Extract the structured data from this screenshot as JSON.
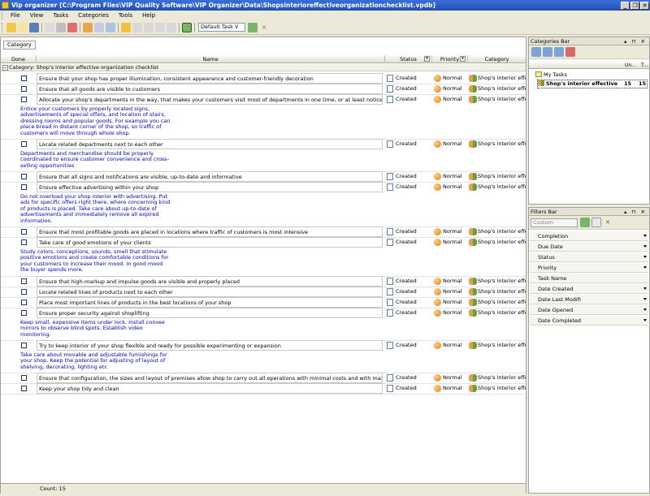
{
  "window": {
    "title": "Vip organizer [C:\\Program Files\\VIP Quality Software\\VIP Organizer\\Data\\Shopsinterioreffectiveorganizationchecklist.vpdb]",
    "buttons": [
      "_",
      "❒",
      "✕"
    ]
  },
  "menu": [
    "File",
    "View",
    "Tasks",
    "Categories",
    "Tools",
    "Help"
  ],
  "toolbar": {
    "view_select": "Default Task V"
  },
  "tasklist": {
    "group_by_label": "Category",
    "columns": {
      "done": "Done",
      "name": "Name",
      "status": "Status",
      "priority": "Priority",
      "category": "Category"
    },
    "group_label": "Category: Shop's interior effective organization checklist",
    "items": [
      {
        "name": "Ensure that your shop has proper illumination, consistent appearance and customer-friendly decoration",
        "status": "Created",
        "priority": "Normal",
        "category": "Shop's interior effe"
      },
      {
        "name": "Ensure that all goods are visible to customers",
        "status": "Created",
        "priority": "Normal",
        "category": "Shop's interior effe"
      },
      {
        "name": "Allocate your shop's departments in the way, that makes your customers visit most of departments in one time, or at least notice all of them",
        "status": "Created",
        "priority": "Normal",
        "category": "Shop's interior effe",
        "note": "Entice your customers by properly located signs, advertisements of special offers, and location of stairs, dressing rooms and popular goods. For example you can place bread in distant corner of the shop, so traffic of customers will move through whole shop."
      },
      {
        "name": "Locate related departments next to each other",
        "status": "Created",
        "priority": "Normal",
        "category": "Shop's interior effe",
        "note": "Departments and merchandise should be properly coordinated to ensure customer convenience and cross-selling opportunities"
      },
      {
        "name": "Ensure that all signs and notifications are visible, up-to-date and informative",
        "status": "Created",
        "priority": "Normal",
        "category": "Shop's interior effe"
      },
      {
        "name": "Ensure effective advertising within your shop",
        "status": "Created",
        "priority": "Normal",
        "category": "Shop's interior effe",
        "note": "Do not overload your shop interior with advertising. Put ads for specific offers right there, where concerning kind of products is placed. Take care about up-to-date of advertisements and immediately remove all expired information."
      },
      {
        "name": "Ensure that most profitable goods are placed in locations where traffic of customers is most intensive",
        "status": "Created",
        "priority": "Normal",
        "category": "Shop's interior effe"
      },
      {
        "name": "Take care of good emotions of your clients",
        "status": "Created",
        "priority": "Normal",
        "category": "Shop's interior effe",
        "note": "Study colors, conceptions, sounds, smell that stimulate positive emotions and create comfortable conditions for your customers to increase their mood. In good mood the buyer spends more."
      },
      {
        "name": "Ensure that  high-markup and impulse goods are visible and properly placed",
        "status": "Created",
        "priority": "Normal",
        "category": "Shop's interior effe"
      },
      {
        "name": "Locate related lines of products next to each other",
        "status": "Created",
        "priority": "Normal",
        "category": "Shop's interior effe"
      },
      {
        "name": "Place most important lines of products in the best locations of your shop",
        "status": "Created",
        "priority": "Normal",
        "category": "Shop's interior effe"
      },
      {
        "name": "Ensure proper security against shoplifting",
        "status": "Created",
        "priority": "Normal",
        "category": "Shop's interior effe",
        "note": "Keep small, expensive items under lock. Install convex mirrors to observe blind spots. Establish video monitoring."
      },
      {
        "name": "Try to keep interior of your shop flexible and ready for possible experimenting or expansion",
        "status": "Created",
        "priority": "Normal",
        "category": "Shop's interior effe",
        "note": "Take care about movable and adjustable furnishings for your shop. Keep the potential for adjusting of layout of shelving, decorating, lighting etc"
      },
      {
        "name": "Ensure that configuration, the sizes and layout of premises allow shop to carry out all operations with minimal costs and with maximum",
        "status": "Created",
        "priority": "Normal",
        "category": "Shop's interior effe"
      },
      {
        "name": "Keep your shop tidy and clean",
        "status": "Created",
        "priority": "Normal",
        "category": "Shop's interior effe"
      }
    ],
    "count_label": "Count: 15"
  },
  "categories_bar": {
    "title": "Categories Bar",
    "columns": [
      "Un...",
      "T..."
    ],
    "my_tasks": "My Tasks",
    "selected": {
      "label": "Shop's interior effective",
      "uncompleted": "15",
      "total": "15"
    }
  },
  "filters_bar": {
    "title": "Filters Bar",
    "combo": "Custom",
    "filters": [
      "Completion",
      "Due Date",
      "Status",
      "Priority",
      "Task Name",
      "Date Created",
      "Date Last Modifi",
      "Date Opened",
      "Date Completed"
    ]
  },
  "colors": {
    "title_bar": "#2556c3",
    "note_text": "#0000cc",
    "accent": "#3a6fd8"
  }
}
